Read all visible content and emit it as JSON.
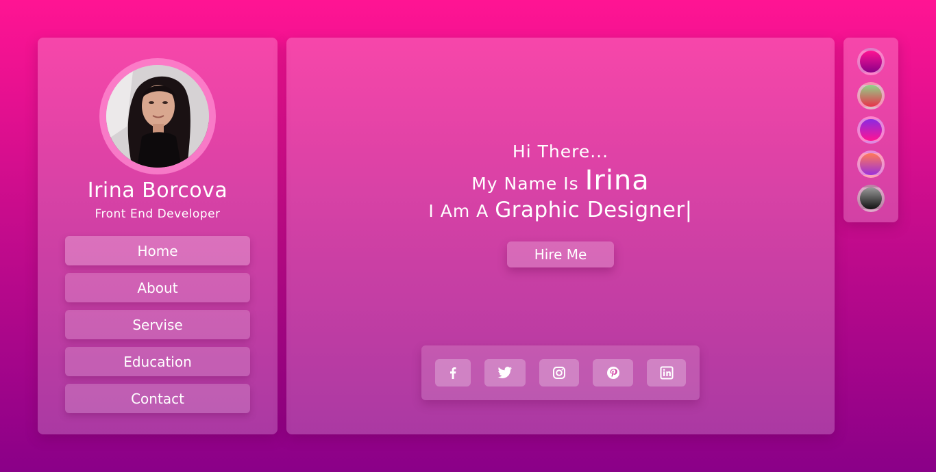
{
  "profile": {
    "name": "Irina Borcova",
    "role": "Front End Developer"
  },
  "nav": {
    "items": [
      {
        "label": "Home"
      },
      {
        "label": "About"
      },
      {
        "label": "Servise"
      },
      {
        "label": "Education"
      },
      {
        "label": "Contact"
      }
    ]
  },
  "hero": {
    "greeting": "Hi There...",
    "name_prefix": "My Name Is",
    "name": "Irina",
    "role_prefix": "I Am A",
    "role": "Graphic Designer|",
    "hire_label": "Hire Me"
  },
  "social": [
    {
      "icon": "facebook-icon"
    },
    {
      "icon": "twitter-icon"
    },
    {
      "icon": "instagram-icon"
    },
    {
      "icon": "pinterest-icon"
    },
    {
      "icon": "linkedin-icon"
    }
  ],
  "themes": [
    {
      "name": "pink-purple",
      "colors": [
        "#ff1493",
        "#8a0088"
      ]
    },
    {
      "name": "green-red",
      "colors": [
        "#8fd48a",
        "#e8334a"
      ]
    },
    {
      "name": "violet-pink",
      "colors": [
        "#8a2be2",
        "#ff1493"
      ]
    },
    {
      "name": "coral-purple",
      "colors": [
        "#ff7a59",
        "#9b30d9"
      ]
    },
    {
      "name": "gray-black",
      "colors": [
        "#9a9a9a",
        "#111111"
      ]
    }
  ]
}
